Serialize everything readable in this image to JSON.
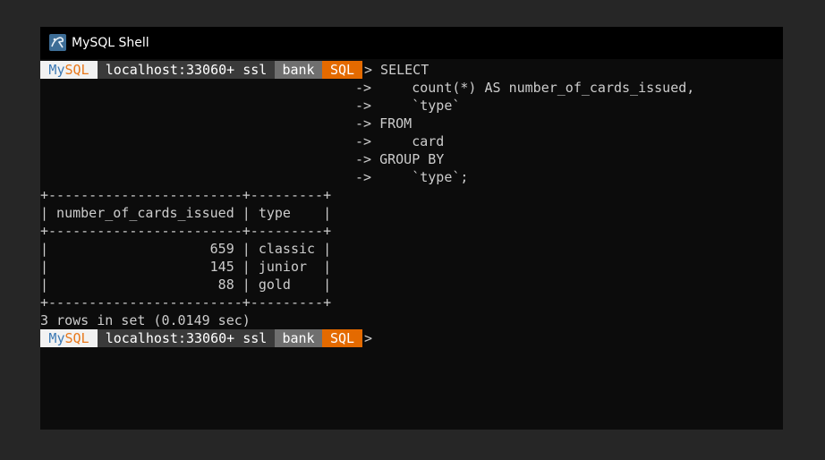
{
  "window": {
    "title": "MySQL Shell",
    "icon": "mysql-shell-icon"
  },
  "prompt": {
    "product_prefix": "My",
    "product_suffix": "SQL",
    "host": "localhost:33060+ ssl",
    "schema": "bank",
    "mode": "SQL",
    "arrow": ">"
  },
  "query_lines": [
    "> SELECT",
    "->     count(*) AS number_of_cards_issued,",
    "->     `type`",
    "-> FROM",
    "->     card",
    "-> GROUP BY",
    "->     `type`;"
  ],
  "result": {
    "border": "+------------------------+---------+",
    "header": "| number_of_cards_issued | type    |",
    "columns": [
      "number_of_cards_issued",
      "type"
    ],
    "rows": [
      {
        "text": "|                    659 | classic |",
        "number_of_cards_issued": "659",
        "type": "classic"
      },
      {
        "text": "|                    145 | junior  |",
        "number_of_cards_issued": "145",
        "type": "junior"
      },
      {
        "text": "|                     88 | gold    |",
        "number_of_cards_issued": "88",
        "type": "gold"
      }
    ],
    "summary": "3 rows in set (0.0149 sec)"
  },
  "colors": {
    "terminal_bg": "#0c0c0c",
    "terminal_fg": "#cccccc",
    "accent_orange": "#e46a00",
    "mysql_blue": "#3c79b4"
  }
}
